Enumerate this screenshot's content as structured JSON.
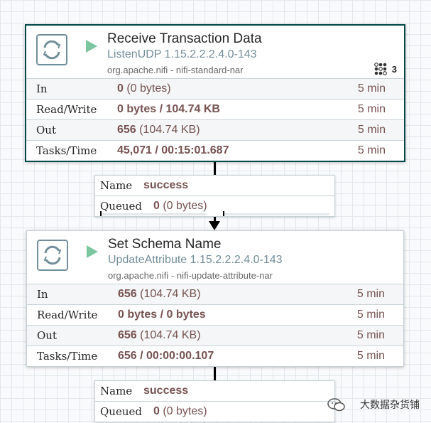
{
  "processors": [
    {
      "name": "Receive Transaction Data",
      "type": "ListenUDP 1.15.2.2.2.4.0-143",
      "bundle": "org.apache.nifi - nifi-standard-nar",
      "active_tasks": "3",
      "stats": {
        "in_label": "In",
        "in_value": "0",
        "in_extra": " (0 bytes)",
        "in_time": "5 min",
        "rw_label": "Read/Write",
        "rw_value": "0 bytes / 104.74 KB",
        "rw_time": "5 min",
        "out_label": "Out",
        "out_value": "656",
        "out_extra": " (104.74 KB)",
        "out_time": "5 min",
        "tasks_label": "Tasks/Time",
        "tasks_value": "45,071 / 00:15:01.687",
        "tasks_time": "5 min"
      }
    },
    {
      "name": "Set Schema Name",
      "type": "UpdateAttribute 1.15.2.2.2.4.0-143",
      "bundle": "org.apache.nifi - nifi-update-attribute-nar",
      "stats": {
        "in_label": "In",
        "in_value": "656",
        "in_extra": " (104.74 KB)",
        "in_time": "5 min",
        "rw_label": "Read/Write",
        "rw_value": "0 bytes / 0 bytes",
        "rw_time": "5 min",
        "out_label": "Out",
        "out_value": "656",
        "out_extra": " (104.74 KB)",
        "out_time": "5 min",
        "tasks_label": "Tasks/Time",
        "tasks_value": "656 / 00:00:00.107",
        "tasks_time": "5 min"
      }
    }
  ],
  "connections": [
    {
      "name_label": "Name",
      "name_value": "success",
      "queued_label": "Queued",
      "queued_value": "0",
      "queued_extra": " (0 bytes)"
    },
    {
      "name_label": "Name",
      "name_value": "success",
      "queued_label": "Queued",
      "queued_value": "0",
      "queued_extra": " (0 bytes)"
    }
  ],
  "watermark": "大数据杂货铺",
  "colors": {
    "selected_border": "#004849",
    "run_icon": "#7dc7a0",
    "type_text": "#728e9b",
    "value_text": "#775351"
  }
}
